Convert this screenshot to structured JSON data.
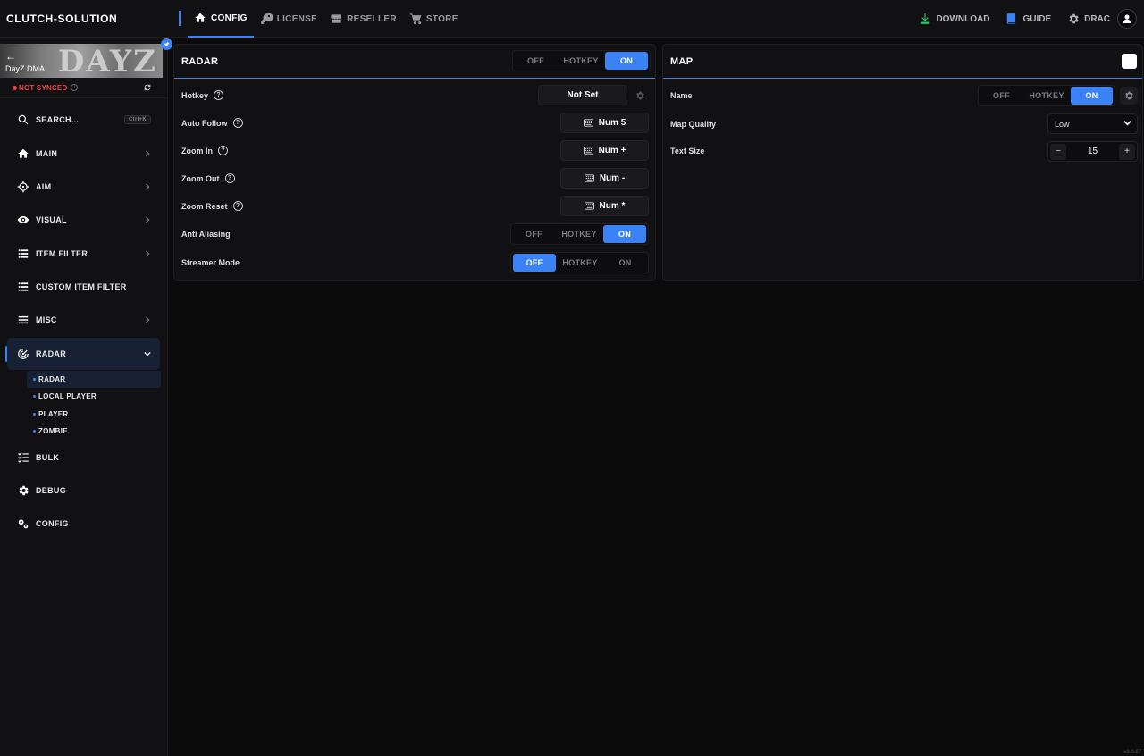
{
  "brand": "CLUTCH-SOLUTION",
  "nav": {
    "tabs": [
      {
        "label": "CONFIG"
      },
      {
        "label": "LICENSE"
      },
      {
        "label": "RESELLER"
      },
      {
        "label": "STORE"
      }
    ],
    "download": "DOWNLOAD",
    "guide": "GUIDE",
    "user": "DRAC"
  },
  "sidebar": {
    "game_name": "DayZ DMA",
    "game_logo": "DAYZ",
    "sync_status": "NOT SYNCED",
    "items": [
      {
        "label": "SEARCH...",
        "shortcut": "Ctrl+K",
        "icon": "search-icon"
      },
      {
        "label": "MAIN",
        "icon": "home-icon"
      },
      {
        "label": "AIM",
        "icon": "crosshair-icon"
      },
      {
        "label": "VISUAL",
        "icon": "eye-icon"
      },
      {
        "label": "ITEM FILTER",
        "icon": "list-icon"
      },
      {
        "label": "CUSTOM ITEM FILTER",
        "icon": "list-icon"
      },
      {
        "label": "MISC",
        "icon": "menu-icon"
      },
      {
        "label": "RADAR",
        "icon": "radar-icon"
      },
      {
        "label": "BULK",
        "icon": "checklist-icon"
      },
      {
        "label": "DEBUG",
        "icon": "gear-icon"
      },
      {
        "label": "CONFIG",
        "icon": "gears-icon"
      }
    ],
    "subitems": [
      "RADAR",
      "LOCAL PLAYER",
      "PLAYER",
      "ZOMBIE"
    ]
  },
  "radar_panel": {
    "title": "RADAR",
    "toggle": {
      "off": "OFF",
      "hotkey": "HOTKEY",
      "on": "ON",
      "selected": "ON"
    },
    "rows": {
      "hotkey": {
        "label": "Hotkey",
        "value": "Not Set"
      },
      "auto_follow": {
        "label": "Auto Follow",
        "value": "Num 5"
      },
      "zoom_in": {
        "label": "Zoom In",
        "value": "Num +"
      },
      "zoom_out": {
        "label": "Zoom Out",
        "value": "Num -"
      },
      "zoom_reset": {
        "label": "Zoom Reset",
        "value": "Num *"
      },
      "anti_aliasing": {
        "label": "Anti Aliasing",
        "off": "OFF",
        "hotkey": "HOTKEY",
        "on": "ON",
        "selected": "ON"
      },
      "streamer_mode": {
        "label": "Streamer Mode",
        "off": "OFF",
        "hotkey": "HOTKEY",
        "on": "ON",
        "selected": "OFF"
      }
    }
  },
  "map_panel": {
    "title": "MAP",
    "rows": {
      "name": {
        "label": "Name",
        "off": "OFF",
        "hotkey": "HOTKEY",
        "on": "ON",
        "selected": "ON"
      },
      "map_quality": {
        "label": "Map Quality",
        "value": "Low"
      },
      "text_size": {
        "label": "Text Size",
        "value": "15",
        "minus": "−",
        "plus": "+"
      }
    }
  },
  "version": "v3.0.87",
  "colors": {
    "accent": "#3b82f6",
    "danger": "#ef4444",
    "download": "#22c55e"
  }
}
